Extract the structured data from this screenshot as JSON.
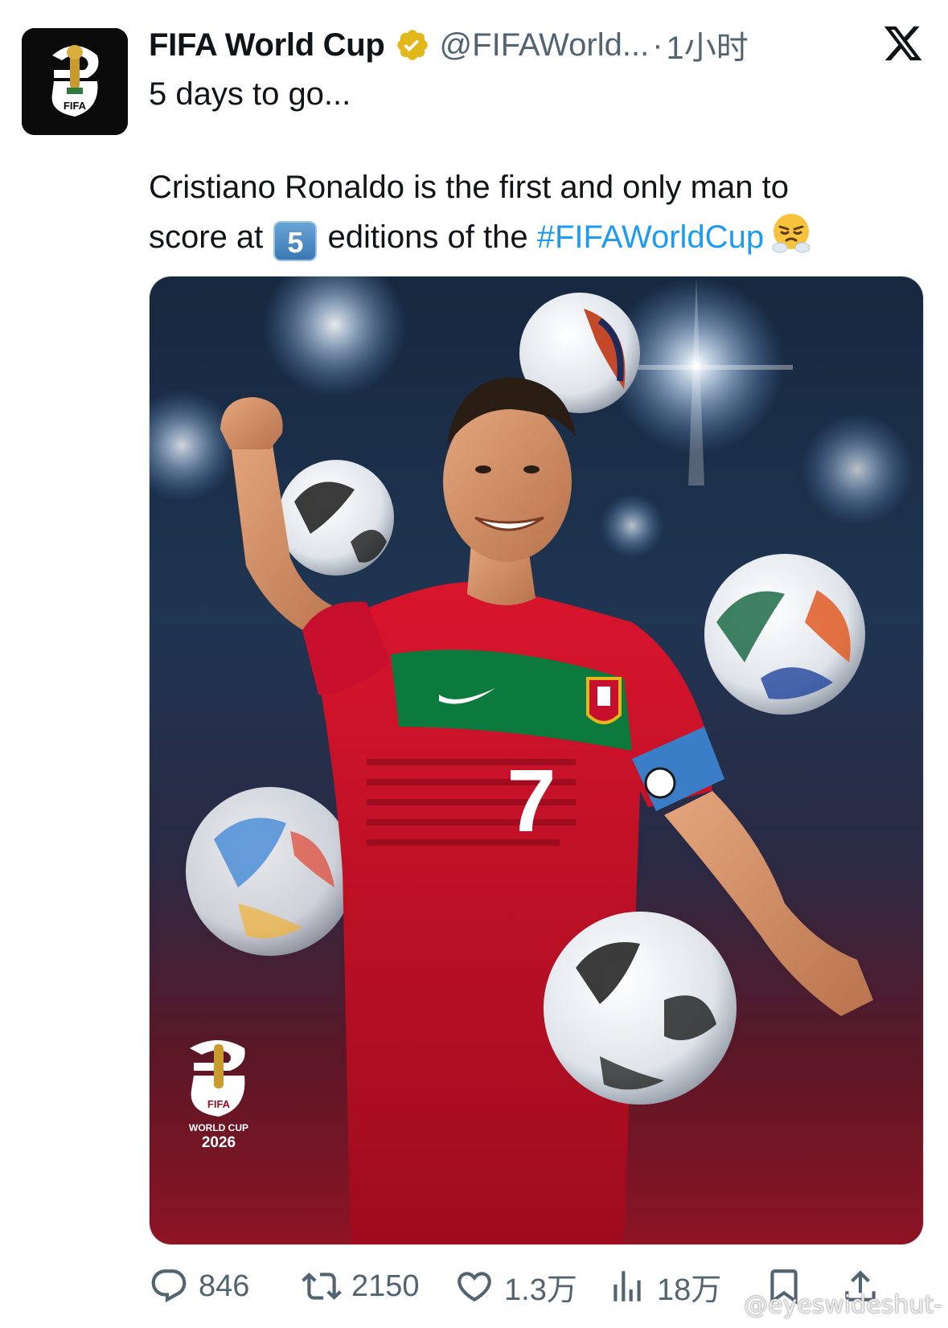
{
  "tweet": {
    "author_name": "FIFA World Cup",
    "handle": "@FIFAWorld...",
    "separator": "·",
    "time": "1小时",
    "line1": "5 days to go...",
    "line2_part1": "Cristiano Ronaldo is the first and only man to",
    "line2_part2": "score at",
    "keycap": "5",
    "line2_part3": "editions of the",
    "hashtag": "#FIFAWorldCup"
  },
  "media": {
    "jersey_number": "7",
    "logo_text_fifa": "FIFA",
    "logo_text_wc": "WORLD CUP",
    "logo_text_year": "2026",
    "avatar_fifa": "FIFA"
  },
  "actions": {
    "replies": "846",
    "retweets": "2150",
    "likes": "1.3万",
    "views": "18万"
  },
  "watermark": "@eyeswideshut-",
  "icons": {
    "verified": "verified-badge-icon",
    "x_logo": "x-logo-icon",
    "reply": "reply-icon",
    "retweet": "retweet-icon",
    "like": "heart-icon",
    "views": "views-chart-icon",
    "bookmark": "bookmark-icon",
    "share": "share-icon"
  },
  "colors": {
    "verified_gold": "#e2b719",
    "hashtag_blue": "#1d9bf0",
    "secondary_text": "#536471",
    "jersey_red": "#c8102e",
    "jersey_green": "#0c7a3c"
  }
}
